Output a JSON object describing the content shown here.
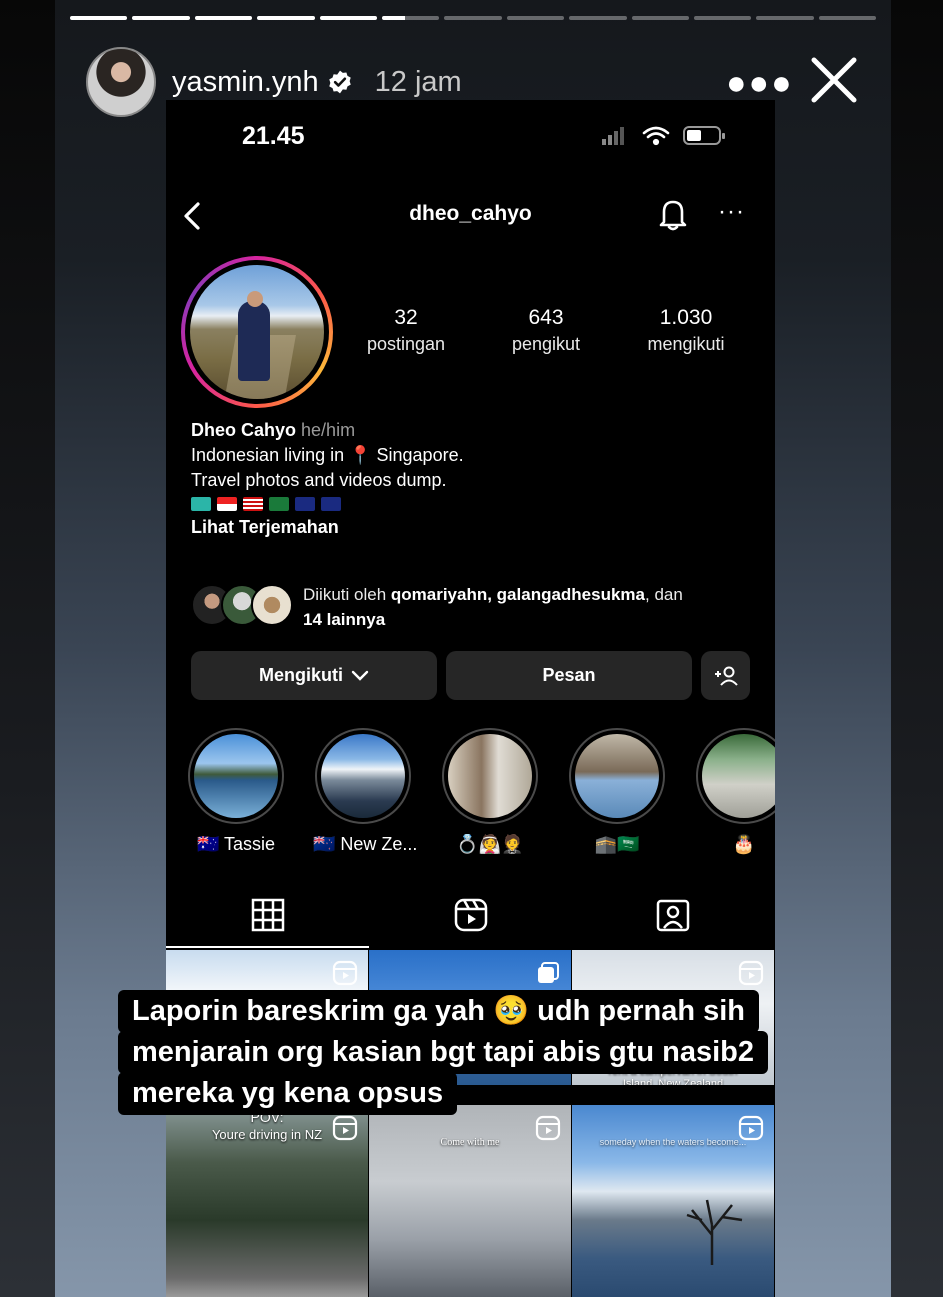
{
  "story": {
    "username": "yasmin.ynh",
    "time_ago": "12 jam",
    "more_icon": "more-horizontal-icon",
    "close_icon": "close-icon",
    "progress_segments_total": 13,
    "progress_segments_done": 5,
    "progress_segment_partial_fraction": 0.4,
    "caption_lines": [
      "Laporin bareskrim ga yah 🥹 udh pernah sih",
      "menjarain org kasian bgt tapi abis gtu nasib2",
      "mereka yg kena opsus"
    ]
  },
  "status_bar": {
    "time": "21.45"
  },
  "profile": {
    "handle": "dheo_cahyo",
    "stats": [
      {
        "num": "32",
        "label": "postingan"
      },
      {
        "num": "643",
        "label": "pengikut"
      },
      {
        "num": "1.030",
        "label": "mengikuti"
      }
    ],
    "name": "Dheo Cahyo",
    "pronouns": "he/him",
    "bio_line1": "Indonesian living in 📍 Singapore.",
    "bio_line2": "Travel photos and videos dump.",
    "translate": "Lihat Terjemahan",
    "followed_by_prefix": "Diikuti oleh ",
    "followed_by_names": "qomariyahn, galangadhesukma",
    "followed_by_suffix": ", dan",
    "followed_by_more": "14 lainnya"
  },
  "buttons": {
    "following": "Mengikuti",
    "message": "Pesan"
  },
  "highlights": [
    {
      "label": "🇦🇺 Tassie"
    },
    {
      "label": "🇳🇿 New Ze..."
    },
    {
      "label": "💍👰🤵"
    },
    {
      "label": "🕋🇸🇦"
    },
    {
      "label": "🎂"
    }
  ],
  "grid_texts": {
    "cell5": "It's a ✨sign✨ for you to rent a campervan in South Island, New Zealand",
    "cell7_pov": "POV:",
    "cell7_line": "Youre driving in NZ",
    "cell8": "Come with me",
    "cell9": "someday when the waters become..."
  },
  "colors": {
    "ig_button_bg": "#262626",
    "story_ring_gradient": "#d6249f,#fd5949,#fdb83a"
  }
}
